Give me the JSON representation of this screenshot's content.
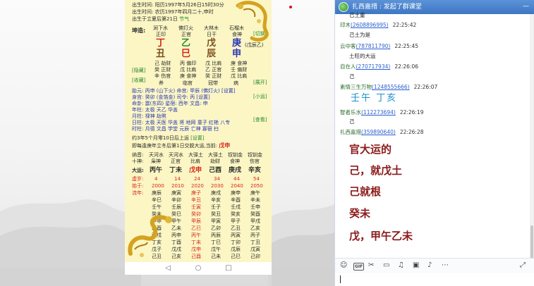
{
  "paper": {
    "header": [
      "出生时间: 阳历1997年5月26日15时30分",
      "出生时间: 农历1997年四月二十,申时",
      "出生于立夏后第21日"
    ],
    "header_tag": "节气",
    "side_labels": {
      "kunzao": "坤造:",
      "qiegu": "[切换]",
      "yincang": "[隐藏]",
      "shoucang": "[收藏]",
      "zhankai": "[展开]",
      "xiaoyun": "[小运]",
      "chakan": "[查看]"
    },
    "shishen_top": [
      "正印",
      "正官",
      "日干",
      "食神"
    ],
    "nayin_top": [
      "涧下水",
      "佛灯火",
      "大林木",
      "石榴木"
    ],
    "gan": [
      "丁",
      "乙",
      "戊",
      "庚"
    ],
    "zhi": [
      "丑",
      "巳",
      "辰",
      "申"
    ],
    "sub_tag": "(戊辰乙)",
    "canggan": [
      [
        "己 劫财",
        "丙 偏印",
        "戊 比肩",
        "庚 食神"
      ],
      [
        "癸 正财",
        "戊 比肩",
        "乙 正官",
        "壬 偏财"
      ],
      [
        "辛 伤官",
        "庚 食神",
        "癸 正财",
        "戊 比肩"
      ]
    ],
    "shensha_row": [
      "养",
      "临官",
      "冠带",
      "病"
    ],
    "info_lines": [
      "胎元: 丙申 (山下火)  命宫: 甲辰 (佛灯火) [设置]",
      "身宫: 癸卯 (金箔金)  司令: 丙 [设置]",
      "命卦: 震(东四)  星宿: 西年  文昌: 申",
      "年柱: 太极 天乙 华盖",
      "月柱: 禄神 劫煞",
      "日柱: 太极 天医 华盖 将 地网 童子 红艳 八专",
      "时柱: 月德 文昌 学堂 元辰 亡神 寡宿 扫"
    ],
    "qiyun": "约3年5个月零10日后上运",
    "qiyun_tag": "[设置]",
    "jiaoyun": "即每逢庚年立冬后第1日交脱大运,当前:",
    "jiaoyun_current": "戊申",
    "dayun_label": "纳音:",
    "dayun_nayin": [
      "天河水",
      "天河水",
      "大驿土",
      "大驿土",
      "钗钏金",
      "钗钏金"
    ],
    "dayun_shishen_label": "十神:",
    "dayun_shishen": [
      "枭神",
      "正官",
      "比肩",
      "劫财",
      "食神",
      "伤官"
    ],
    "dayun_label2": "大运:",
    "dayun": [
      "丙午",
      "丁未",
      "戊申",
      "己酉",
      "庚戌",
      "辛亥"
    ],
    "xusui_label": "虚岁:",
    "xusui": [
      "4",
      "14",
      "24",
      "34",
      "44",
      "54"
    ],
    "shinian_label": "始于:",
    "shinian": [
      "2000",
      "2010",
      "2020",
      "2030",
      "2040",
      "2050"
    ],
    "liunian_label": "流年:",
    "liunian": [
      [
        "庚辰",
        "庚寅",
        "庚子",
        "庚戌",
        "庚申",
        "庚午"
      ],
      [
        "辛巳",
        "辛卯",
        "辛丑",
        "辛亥",
        "辛酉",
        "辛未"
      ],
      [
        "壬午",
        "壬辰",
        "壬寅",
        "壬子",
        "壬戌",
        "壬申"
      ],
      [
        "癸未",
        "癸巳",
        "癸卯",
        "癸丑",
        "癸亥",
        "癸酉"
      ],
      [
        "甲申",
        "甲午",
        "甲辰",
        "甲寅",
        "甲子",
        "甲戌"
      ],
      [
        "乙酉",
        "乙未",
        "乙巳",
        "乙卯",
        "乙丑",
        "乙亥"
      ],
      [
        "丙戌",
        "丙申",
        "丙午",
        "丙辰",
        "丙寅",
        "丙子"
      ],
      [
        "丁亥",
        "丁酉",
        "丁未",
        "丁巳",
        "丁卯",
        "丁丑"
      ],
      [
        "戊子",
        "戊戌",
        "戊申",
        "戊午",
        "戊辰",
        "戊寅"
      ],
      [
        "己丑",
        "己亥",
        "己酉",
        "己未",
        "己巳",
        "己卯"
      ]
    ]
  },
  "phone_nav": {
    "back": "◁",
    "home": "○",
    "recent": "□"
  },
  "chat": {
    "title": "扎西嘉措 : 发起了群课堂",
    "min_icon": "—",
    "top_clip": "己土重",
    "messages": [
      {
        "name": "印木",
        "uid": "(2608896995)",
        "time": "22:25:42",
        "text": "己土为是"
      },
      {
        "name": "云中客",
        "uid": "(787811790)",
        "time": "22:25:45",
        "text": "土旺的大运"
      },
      {
        "name": "自在人",
        "uid": "(270717934)",
        "time": "22:26:06",
        "text": "己"
      },
      {
        "name": "素情三生万物",
        "uid": "(1248555666)",
        "time": "22:26:07",
        "text": "壬午   丁亥"
      },
      {
        "name": "智者乐水",
        "uid": "(112273694)",
        "time": "22:26:19",
        "text": "己"
      },
      {
        "name": "扎西嘉措",
        "uid": "(359890640)",
        "time": "22:26:28",
        "text": ""
      }
    ],
    "big_lines": [
      "官大运的",
      "己，就戊土",
      "己就根",
      "癸未",
      "戊，甲午乙未"
    ],
    "toolbar": {
      "emoji": "☺",
      "gif": "GIF",
      "cut": "✂",
      "file": "▭",
      "music": "♫",
      "image": "▣",
      "bell": "♪",
      "more": "⋯",
      "expand": "⤢"
    }
  }
}
